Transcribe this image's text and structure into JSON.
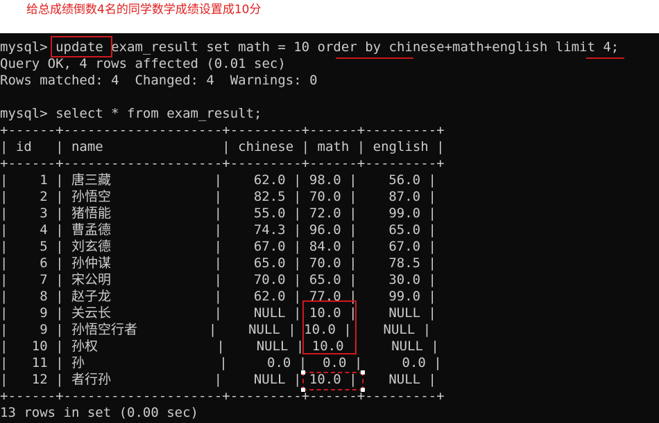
{
  "caption": "给总成绩倒数4名的同学数学成绩设置成10分",
  "terminal": {
    "lines": [
      "mysql> update exam_result set math = 10 order by chinese+math+english limit 4;",
      "Query OK, 4 rows affected (0.01 sec)",
      "Rows matched: 4  Changed: 4  Warnings: 0",
      "",
      "mysql> select * from exam_result;",
      "+------+--------------------+---------+------+---------+",
      "| id   | name               | chinese | math | english |",
      "+------+--------------------+---------+------+---------+",
      "|    1 | 唐三藏             |    62.0 | 98.0 |    56.0 |",
      "|    2 | 孙悟空             |    82.5 | 70.0 |    87.0 |",
      "|    3 | 猪悟能             |    55.0 | 72.0 |    99.0 |",
      "|    4 | 曹孟德             |    74.3 | 96.0 |    65.0 |",
      "|    5 | 刘玄德             |    67.0 | 84.0 |    67.0 |",
      "|    6 | 孙仲谋             |    65.0 | 70.0 |    78.5 |",
      "|    7 | 宋公明             |    70.0 | 65.0 |    30.0 |",
      "|    8 | 赵子龙             |    62.0 | 77.0 |    99.0 |",
      "|    9 | 关云长             |    NULL | 10.0 |    NULL |",
      "|    9 | 孙悟空行者         |    NULL | 10.0 |    NULL |",
      "|   10 | 孙权               |    NULL | 10.0 |    NULL |",
      "|   11 | 孙                 |     0.0 |  0.0 |     0.0 |",
      "|   12 | 者行孙             |    NULL | 10.0 |    NULL |",
      "+------+--------------------+---------+------+---------+",
      "13 rows in set (0.00 sec)"
    ]
  },
  "colors": {
    "terminal_bg": "#0c0c0c",
    "terminal_text": "#cccccc",
    "annotation": "#d0191e"
  }
}
